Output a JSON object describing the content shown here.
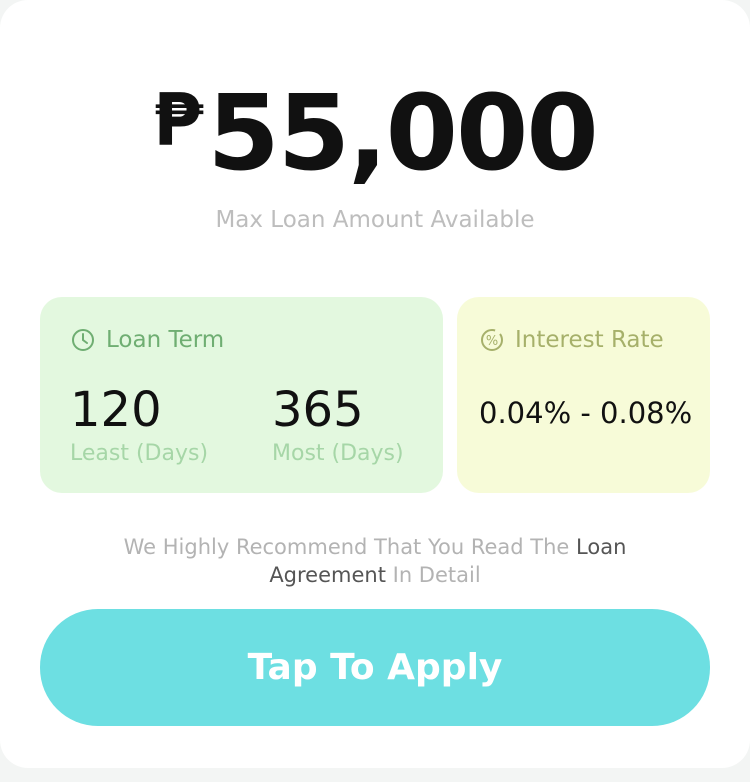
{
  "loan": {
    "currency": "₱",
    "max_amount": "55,000",
    "subtitle": "Max Loan Amount Available"
  },
  "term": {
    "title": "Loan Term",
    "least_value": "120",
    "least_caption": "Least (Days)",
    "most_value": "365",
    "most_caption": "Most (Days)",
    "icon": "clock-icon",
    "accent_color": "#6fae72",
    "background_color": "#e3f8df"
  },
  "interest": {
    "title": "Interest Rate",
    "value": "0.04% - 0.08%",
    "icon": "percent-icon",
    "accent_color": "#a6b06a",
    "background_color": "#f7fbd8"
  },
  "notice": {
    "prefix": "We Highly Recommend That You Read The ",
    "link_text": "Loan Agreement",
    "suffix": " In Detail"
  },
  "apply": {
    "label": "Tap To Apply",
    "color": "#6ddfe2"
  }
}
